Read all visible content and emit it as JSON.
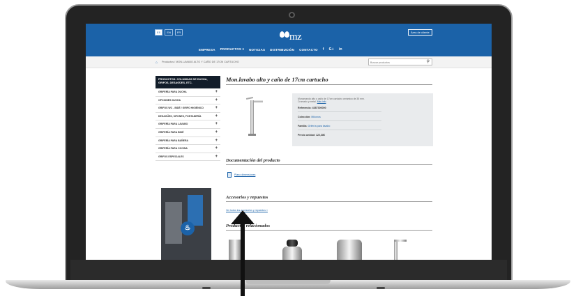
{
  "header": {
    "languages": [
      "ES",
      "EN",
      "FR"
    ],
    "logo_text": "mz",
    "area_button": "Área de cliente",
    "nav": [
      "EMPRESA",
      "PRODUCTOS",
      "NOTICIAS",
      "DISTRIBUCIÓN",
      "CONTACTO"
    ],
    "social": [
      "f",
      "G+",
      "in"
    ]
  },
  "breadcrumb": {
    "home_icon": "home-icon",
    "trail": "Productos  /  MON.LAVABO ALTO Y CAÑO DE 17CM CARTUCHO"
  },
  "search": {
    "placeholder": "Buscar productos"
  },
  "sidebar": {
    "title": "PRODUCTOS: COLUMNAS DE DUCHA, GRIFOS, DESAGÜES, ETC.",
    "items": [
      {
        "label": "GRIFERÍA PARA DUCHA"
      },
      {
        "label": "OPCIONES DUCHA"
      },
      {
        "label": "GRIFOS WC - BIDÉ / GRIFO HIGIÉNICO"
      },
      {
        "label": "DESAGÜES, SIFONES, FONTANERÍA"
      },
      {
        "label": "GRIFERÍA PARA LAVABO"
      },
      {
        "label": "GRIFERÍA PARA BIDÉ"
      },
      {
        "label": "GRIFERÍA PARA BAÑERA"
      },
      {
        "label": "GRIFERÍA PARA COCINA"
      },
      {
        "label": "GRIFOS ESPECIALES"
      }
    ]
  },
  "product": {
    "title": "Mon.lavabo alto y caño de 17cm cartucho",
    "description": "Monomando alto y caño de 17cm cartucho cerámico de 35 mm. Cromado y metal.",
    "desc_link": "Más info",
    "reference_label": "Referencia:",
    "reference_value": "4387300000",
    "collection_label": "Colección:",
    "collection_value": "Mikonos",
    "family_label": "Familia:",
    "family_value": "Grifería para lavabo",
    "price_label": "Precio unidad:",
    "price_value": "122,38€"
  },
  "documentation": {
    "title": "Documentación del producto",
    "file_label": "Plano dimensiones"
  },
  "accessories": {
    "title": "Accesorios y repuestos",
    "link": "Ver todos los accesorios y repuestos »"
  },
  "related": {
    "title": "Productos relacionados"
  }
}
